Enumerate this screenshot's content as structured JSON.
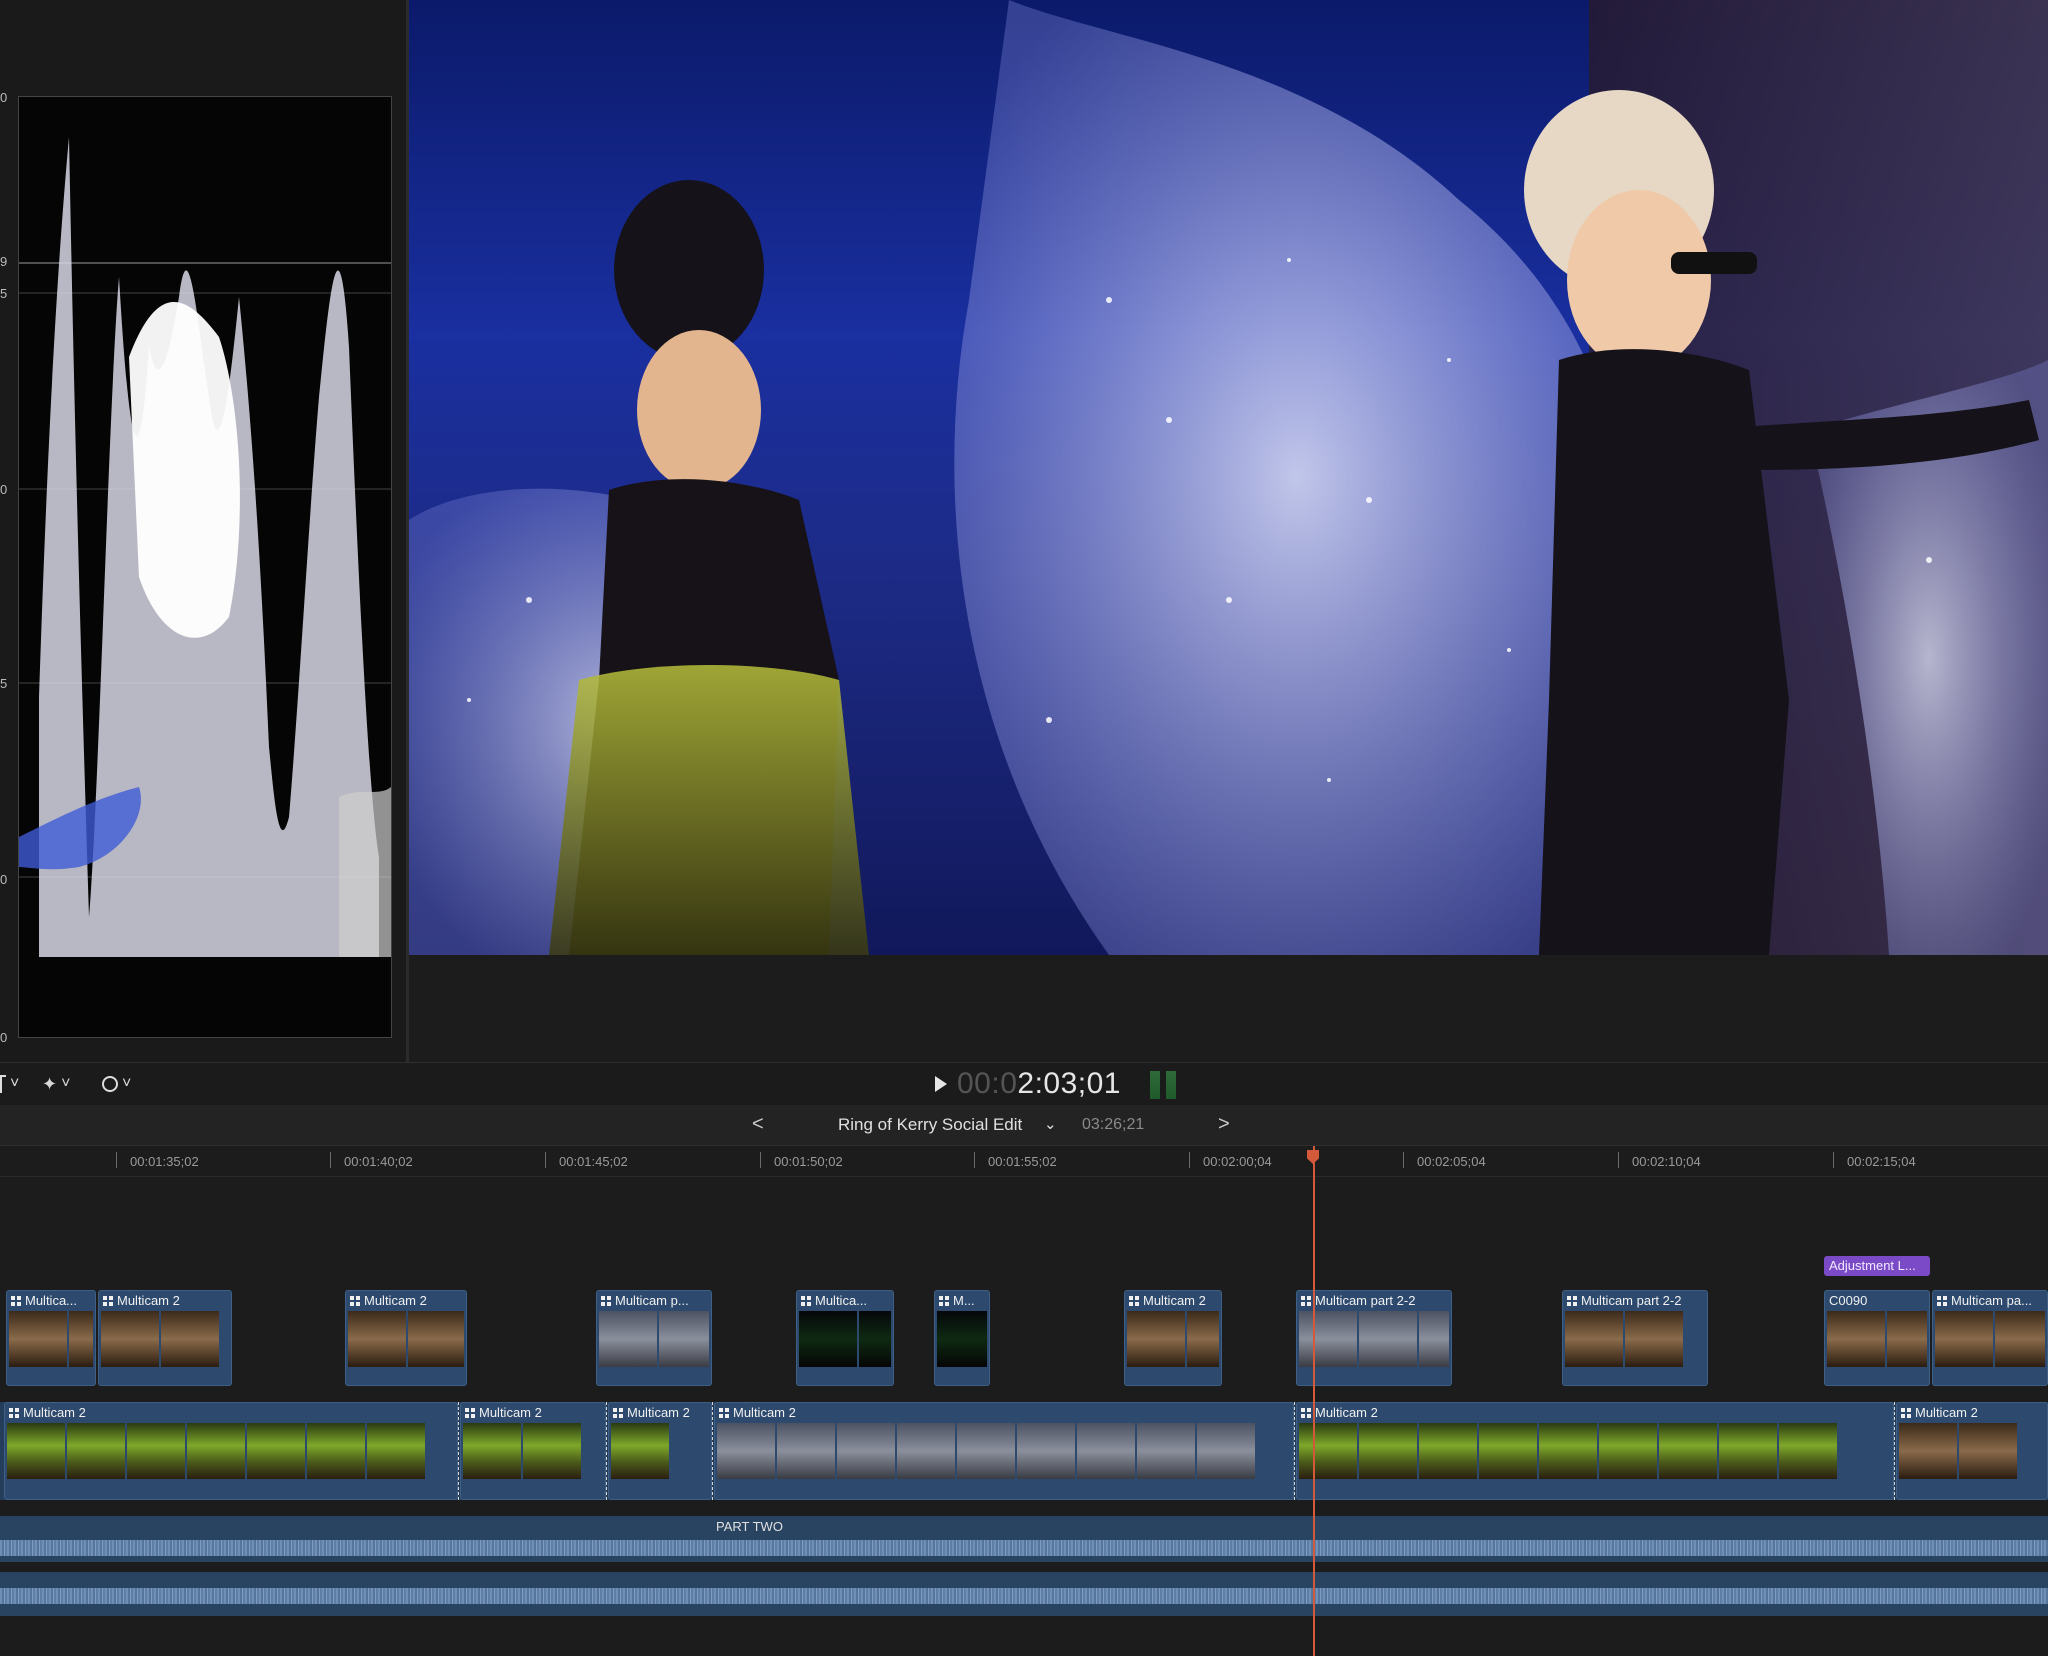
{
  "scopes": {
    "scale_labels": [
      "0",
      "9",
      "5",
      "0",
      "5",
      "0",
      "0"
    ]
  },
  "viewer": {
    "frame_description_icon": "video-frame"
  },
  "toolbar": {
    "tools": [
      {
        "icon": "trim-tool-icon",
        "chevron": "˅"
      },
      {
        "icon": "magic-wand-icon",
        "chevron": "˅"
      },
      {
        "icon": "speedometer-icon",
        "chevron": "˅"
      }
    ],
    "timecode_dim": "00:0",
    "timecode_lit": "2:03;01"
  },
  "project": {
    "title": "Ring of Kerry Social Edit",
    "chevron": "⌄",
    "duration": "03:26;21",
    "back": "<",
    "forward": ">"
  },
  "ruler": {
    "labels": [
      "00:01:35;02",
      "00:01:40;02",
      "00:01:45;02",
      "00:01:50;02",
      "00:01:55;02",
      "00:02:00;04",
      "00:02:05;04",
      "00:02:10;04",
      "00:02:15;04"
    ]
  },
  "connected_clips": [
    {
      "title": "Multica..."
    },
    {
      "title": "Multicam 2"
    },
    {
      "title": "Multicam 2"
    },
    {
      "title": "Multicam p..."
    },
    {
      "title": "Multica..."
    },
    {
      "title": "M..."
    },
    {
      "title": "Multicam 2"
    },
    {
      "title": "Multicam part 2-2"
    },
    {
      "title": "Multicam part 2-2"
    },
    {
      "title": "C0090"
    },
    {
      "title": "Multicam pa..."
    }
  ],
  "adjustment_layer": {
    "title": "Adjustment L..."
  },
  "primary_clips": [
    {
      "title": "Multicam 2"
    },
    {
      "title": "Multicam 2"
    },
    {
      "title": "Multicam 2"
    },
    {
      "title": "Multicam 2"
    },
    {
      "title": "Multicam 2"
    },
    {
      "title": "Multicam 2"
    }
  ],
  "audio": {
    "role_label": "PART TWO"
  },
  "colors": {
    "clip_blue": "#2d4a6e",
    "adjustment_purple": "#7b4ac6",
    "playhead": "#d25a3a"
  }
}
